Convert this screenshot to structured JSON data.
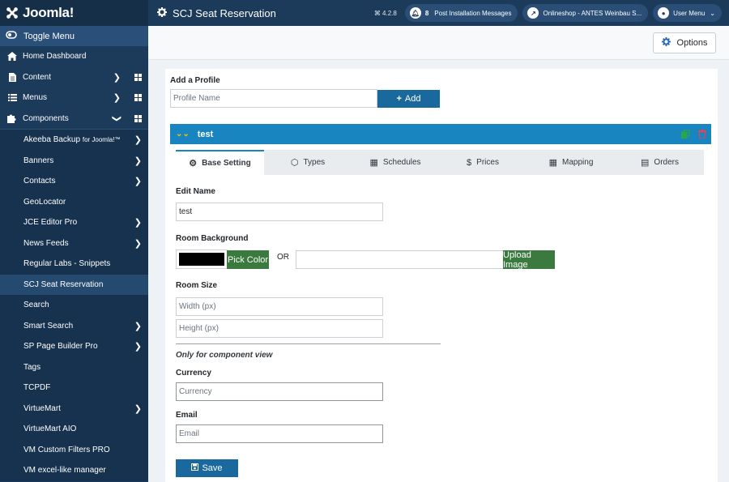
{
  "brand": {
    "name": "Joomla!"
  },
  "sidebar": {
    "toggle_label": "Toggle Menu",
    "items": [
      {
        "label": "Home Dashboard",
        "icon": "home-icon"
      },
      {
        "label": "Content",
        "icon": "file-icon"
      },
      {
        "label": "Menus",
        "icon": "list-icon"
      },
      {
        "label": "Components",
        "icon": "puzzle-icon"
      }
    ],
    "components": [
      {
        "label": "Akeeba Backup",
        "suffix": "for Joomla!",
        "tm": "™"
      },
      {
        "label": "Banners"
      },
      {
        "label": "Contacts"
      },
      {
        "label": "GeoLocator"
      },
      {
        "label": "JCE Editor Pro"
      },
      {
        "label": "News Feeds"
      },
      {
        "label": "Regular Labs - Snippets"
      },
      {
        "label": "SCJ Seat Reservation"
      },
      {
        "label": "Search"
      },
      {
        "label": "Smart Search"
      },
      {
        "label": "SP Page Builder Pro"
      },
      {
        "label": "Tags"
      },
      {
        "label": "TCPDF"
      },
      {
        "label": "VirtueMart"
      },
      {
        "label": "VirtueMart AIO"
      },
      {
        "label": "VM Custom Filters PRO"
      },
      {
        "label": "VM excel-like manager"
      }
    ]
  },
  "header": {
    "title": "SCJ Seat Reservation",
    "version": "⌘ 4.2.8",
    "messages_count": "8",
    "messages_label": "Post Installation Messages",
    "site_label": "Onlineshop - ANTES Weinbau S...",
    "user_label": "User Menu"
  },
  "toolbar": {
    "options_label": "Options"
  },
  "form": {
    "add_profile_label": "Add a Profile",
    "profile_name_placeholder": "Profile Name",
    "add_button": "Add",
    "profile_name": "test",
    "tabs": [
      {
        "label": "Base Setting",
        "icon": "gear-icon"
      },
      {
        "label": "Types",
        "icon": "cube-icon"
      },
      {
        "label": "Schedules",
        "icon": "calendar-icon"
      },
      {
        "label": "Prices",
        "icon": "dollar-icon"
      },
      {
        "label": "Mapping",
        "icon": "grid-icon"
      },
      {
        "label": "Orders",
        "icon": "document-icon"
      }
    ],
    "edit_name_label": "Edit Name",
    "edit_name_value": "test",
    "room_background_label": "Room Background",
    "background_color": "#000000",
    "pick_color_button": "Pick Color",
    "or_label": "OR",
    "upload_image_button": "Upload Image",
    "room_size_label": "Room Size",
    "width_placeholder": "Width (px)",
    "height_placeholder": "Height (px)",
    "component_view_label": "Only for component view",
    "currency_label": "Currency",
    "currency_placeholder": "Currency",
    "email_label": "Email",
    "email_placeholder": "Email",
    "save_button": "Save"
  },
  "colors": {
    "sidebar": "#1c3a5a",
    "accent_blue": "#1985c0",
    "button_blue": "#19699f",
    "button_green": "#3a7a3e",
    "delete_red": "#e0455a"
  }
}
